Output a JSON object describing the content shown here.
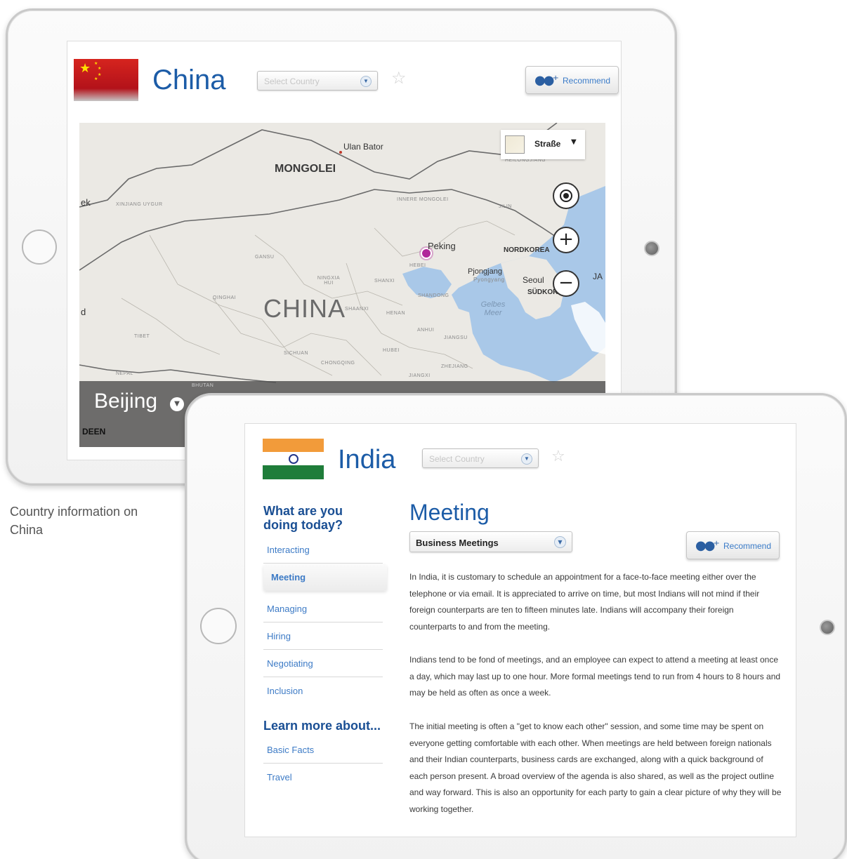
{
  "china": {
    "country_name": "China",
    "select_placeholder": "Select Country",
    "recommend_label": "Recommend",
    "map_type_label": "Straße",
    "city": "Beijing",
    "language_tag": "DEEN",
    "map_labels": {
      "ulan_bator": "Ulan Bator",
      "mongolei": "MONGOLEI",
      "ek": "ek",
      "xinjiang": "XINJIANG UYGUR",
      "inner_mongolei": "INNERE MONGOLEI",
      "jilin": "JILIN",
      "heilongjiang": "HEILONGJIANG",
      "peking": "Peking",
      "hebei": "HEBEI",
      "nordkorea": "NORDKOREA",
      "gansu": "GANSU",
      "ningxia": "NINGXIA HUI",
      "shanxi": "SHANXI",
      "pjongjang": "Pjongjang",
      "pyongyang": "Pyongyang",
      "seoul": "Seoul",
      "sudkorea": "SÜDKOREA",
      "ja": "JA",
      "qinghai": "QINGHAI",
      "china": "CHINA",
      "shaanxi": "SHAANXI",
      "henan": "HENAN",
      "shandong": "SHANDONG",
      "gelbes_meer": "Gelbes Meer",
      "anhui": "ANHUI",
      "jiangsu": "JIANGSU",
      "tibet": "TIBET",
      "hubei": "HUBEI",
      "sichuan": "SICHUAN",
      "chongqing": "CHONGQING",
      "zhejiang": "ZHEJIANG",
      "nepal": "NEPAL",
      "bhutan": "BHUTAN",
      "jiangxi": "JIANGXI",
      "d": "d"
    }
  },
  "caption": "Country information on China",
  "india": {
    "country_name": "India",
    "select_placeholder": "Select Country",
    "sidebar_heading_1": "What are you doing today?",
    "sidebar_items": [
      "Interacting",
      "Meeting",
      "Managing",
      "Hiring",
      "Negotiating",
      "Inclusion"
    ],
    "active_item": "Meeting",
    "sidebar_heading_2": "Learn more about...",
    "learn_items": [
      "Basic Facts",
      "Travel"
    ],
    "section_title": "Meeting",
    "topic_value": "Business Meetings",
    "recommend_label": "Recommend",
    "paragraphs": [
      "In India, it is customary to schedule an appointment for a face-to-face meeting either over the telephone or via email. It is appreciated to arrive on time, but most Indians will not mind if their foreign counterparts are ten to fifteen minutes late. Indians will accompany their foreign counterparts to and from the meeting.",
      "Indians tend to be fond of meetings, and an employee can expect to attend a meeting at least once a day, which may last up to one hour. More formal meetings tend to run from 4 hours to 8 hours and may be held as often as once a week.",
      "The initial meeting is often a \"get to know each other\" session, and some time may be spent on everyone getting comfortable with each other. When meetings are held between foreign nationals and their Indian counterparts, business cards are exchanged, along with a quick background of each person present. A broad overview of the agenda is also shared, as well as the project outline and way forward. This is also an opportunity for each party to gain a clear picture of why they will be working together."
    ]
  },
  "colors": {
    "brand_blue": "#1c5ca7",
    "link_blue": "#3d7bc6",
    "map_land": "#ebe9e4",
    "map_sea": "#a9c8e8",
    "peking_marker": "#b0279a"
  },
  "icons": {
    "flag_china": "flag-china-icon",
    "flag_india": "flag-india-icon",
    "favorite": "star-outline-icon",
    "recommend": "add-user-icon",
    "locate": "target-icon",
    "zoom_in": "plus-icon",
    "zoom_out": "minus-icon",
    "dropdown": "chevron-down-icon"
  }
}
